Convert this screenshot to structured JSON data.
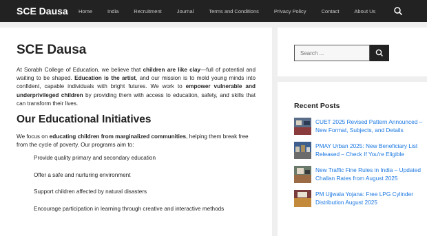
{
  "header": {
    "site_title": "SCE Dausa",
    "menu": [
      "Home",
      "India",
      "Recruitment",
      "Journal",
      "Terms and Conditions",
      "Privacy Policy",
      "Contact",
      "About Us"
    ]
  },
  "article": {
    "title": "SCE Dausa",
    "intro": {
      "p1": "At Sorabh College of Education, we believe that ",
      "b1": "children are like clay",
      "p2": "—full of potential and waiting to be shaped. ",
      "b2": "Education is the artist",
      "p3": ", and our mission is to mold young minds into confident, capable individuals with bright futures. We work to ",
      "b3": "empower vulnerable and underprivileged children",
      "p4": " by providing them with access to education, safety, and skills that can transform their lives."
    },
    "section_title": "Our Educational Initiatives",
    "section_intro": {
      "p1": "We focus on ",
      "b1": "educating children from marginalized communities",
      "p2": ", helping them break free from the cycle of poverty. Our programs aim to:"
    },
    "bullets": [
      "Provide quality primary and secondary education",
      "Offer a safe and nurturing environment",
      "Support children affected by natural disasters",
      "Encourage participation in learning through creative and interactive methods"
    ]
  },
  "sidebar": {
    "search_placeholder": "Search ...",
    "recent_title": "Recent Posts",
    "posts": [
      "CUET 2025 Revised Pattern Announced – New Format, Subjects, and Details",
      "PMAY Urban 2025: New Beneficiary List Released – Check If You're Eligible",
      "New Traffic Fine Rules in India – Updated Challan Rates from August 2025",
      "PM Ujjwala Yojana: Free LPG Cylinder Distribution August 2025"
    ]
  },
  "colors": {
    "nav_bg": "#222222",
    "link": "#1b78e2",
    "page_bg": "#efefef"
  },
  "icons": {
    "nav_search": "search-icon",
    "sidebar_search": "search-icon"
  }
}
